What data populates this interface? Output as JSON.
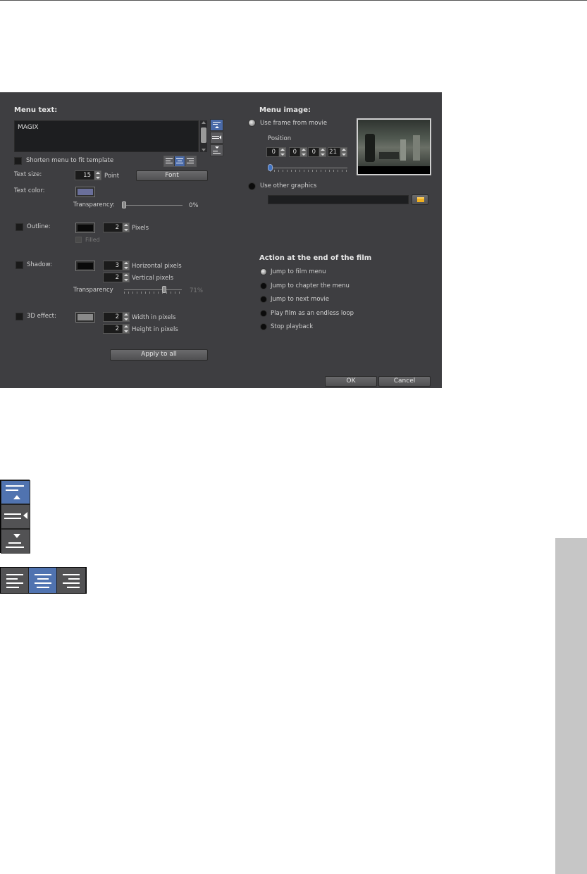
{
  "dialog": {
    "menu_text": {
      "header": "Menu text:",
      "value": "MAGIX",
      "shorten_label": "Shorten menu to fit template",
      "text_size_label": "Text size:",
      "text_size_value": "15",
      "text_size_unit": "Point",
      "font_button": "Font",
      "text_color_label": "Text color:",
      "text_color": "#6a6f9a",
      "transparency_label": "Transparency:",
      "transparency_value": "0%",
      "transparency_level": 0,
      "outline_label": "Outline:",
      "outline_color": "#0a0a0a",
      "outline_value": "2",
      "outline_unit": "Pixels",
      "filled_label": "Filled",
      "shadow_label": "Shadow:",
      "shadow_color": "#0a0a0a",
      "shadow_h_value": "3",
      "shadow_h_unit": "Horizontal pixels",
      "shadow_v_value": "2",
      "shadow_v_unit": "Vertical pixels",
      "shadow_transparency_label": "Transparency",
      "shadow_transparency_value": "71%",
      "shadow_transparency_level": 0.71,
      "effect3d_label": "3D effect:",
      "effect3d_color": "#8a8a8a",
      "width_value": "2",
      "width_unit": "Width in pixels",
      "height_value": "2",
      "height_unit": "Height in pixels",
      "apply_all_button": "Apply to all"
    },
    "menu_image": {
      "header": "Menu image:",
      "use_frame_label": "Use frame from movie",
      "position_label": "Position",
      "pos_values": [
        "0",
        "0",
        "0",
        "21"
      ],
      "use_other_label": "Use other graphics",
      "folder_icon": "folder-icon"
    },
    "action": {
      "header": "Action at the end of the film",
      "options": [
        "Jump to film menu",
        "Jump to chapter the menu",
        "Jump to next movie",
        "Play film as an endless loop",
        "Stop playback"
      ],
      "selected": 0
    },
    "ok_button": "OK",
    "cancel_button": "Cancel"
  },
  "accent": "#4a6aa8"
}
